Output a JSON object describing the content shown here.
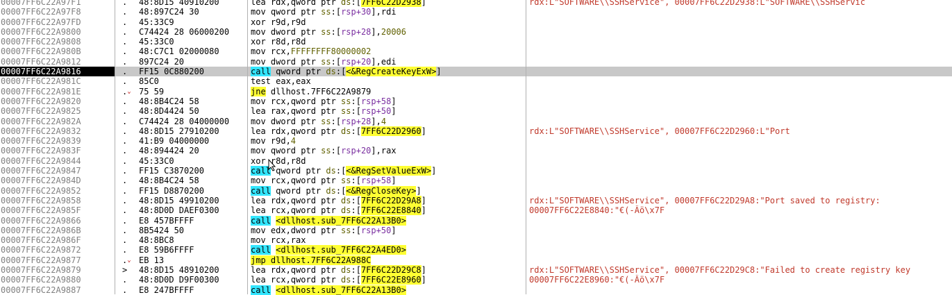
{
  "colors": {
    "address_gray": "#808080",
    "selected_row_bg": "#c8c8c8",
    "selected_addr_bg": "#000000",
    "call_highlight": "#33e6ff",
    "jump_highlight": "#ffff33",
    "comment_color": "#c0392b",
    "jump_arrow_color": "#c00000"
  },
  "rows": [
    {
      "addr": "00007FF6C22A97F1",
      "mark": ".",
      "bytes": "48:8D15 40910200",
      "instr": [
        {
          "t": "lea rdx,qword ptr "
        },
        {
          "t": "ds",
          "c": "seg"
        },
        {
          "t": ":["
        },
        {
          "t": "7FF6C22D2938",
          "c": "hl-y"
        },
        {
          "t": "]"
        }
      ],
      "comment": "rdx:L\"SOFTWARE\\\\SSHService\", 00007FF6C22D2938:L\"SOFTWARE\\\\SSHServic"
    },
    {
      "addr": "00007FF6C22A97F8",
      "mark": ".",
      "bytes": "48:897C24 30",
      "instr": [
        {
          "t": "mov qword ptr "
        },
        {
          "t": "ss",
          "c": "seg"
        },
        {
          "t": ":["
        },
        {
          "t": "rsp+30",
          "c": "reg"
        },
        {
          "t": "],rdi"
        }
      ],
      "comment": ""
    },
    {
      "addr": "00007FF6C22A97FD",
      "mark": ".",
      "bytes": "45:33C9",
      "instr": [
        {
          "t": "xor r9d,r9d"
        }
      ],
      "comment": ""
    },
    {
      "addr": "00007FF6C22A9800",
      "mark": ".",
      "bytes": "C74424 28 06000200",
      "instr": [
        {
          "t": "mov dword ptr "
        },
        {
          "t": "ss",
          "c": "seg"
        },
        {
          "t": ":["
        },
        {
          "t": "rsp+28",
          "c": "reg"
        },
        {
          "t": "],"
        },
        {
          "t": "20006",
          "c": "imm"
        }
      ],
      "comment": ""
    },
    {
      "addr": "00007FF6C22A9808",
      "mark": ".",
      "bytes": "45:33C0",
      "instr": [
        {
          "t": "xor r8d,r8d"
        }
      ],
      "comment": ""
    },
    {
      "addr": "00007FF6C22A980B",
      "mark": ".",
      "bytes": "48:C7C1 02000080",
      "instr": [
        {
          "t": "mov rcx,"
        },
        {
          "t": "FFFFFFFF80000002",
          "c": "imm"
        }
      ],
      "comment": ""
    },
    {
      "addr": "00007FF6C22A9812",
      "mark": ".",
      "bytes": "897C24 20",
      "instr": [
        {
          "t": "mov dword ptr "
        },
        {
          "t": "ss",
          "c": "seg"
        },
        {
          "t": ":["
        },
        {
          "t": "rsp+20",
          "c": "reg"
        },
        {
          "t": "],edi"
        }
      ],
      "comment": ""
    },
    {
      "addr": "00007FF6C22A9816",
      "mark": ".",
      "bytes": "FF15 0C880200",
      "instr": [
        {
          "t": "call",
          "c": "hl-c"
        },
        {
          "t": " qword ptr "
        },
        {
          "t": "ds",
          "c": "seg"
        },
        {
          "t": ":["
        },
        {
          "t": "<&RegCreateKeyExW>",
          "c": "hl-y"
        },
        {
          "t": "]"
        }
      ],
      "comment": "",
      "selected": true
    },
    {
      "addr": "00007FF6C22A981C",
      "mark": ".",
      "bytes": "85C0",
      "instr": [
        {
          "t": "test eax,eax"
        }
      ],
      "comment": ""
    },
    {
      "addr": "00007FF6C22A981E",
      "mark": ".v",
      "bytes": "75 59",
      "instr": [
        {
          "t": "jne",
          "c": "hl-y"
        },
        {
          "t": " dllhost.7FF6C22A9879"
        }
      ],
      "comment": ""
    },
    {
      "addr": "00007FF6C22A9820",
      "mark": ".",
      "bytes": "48:8B4C24 58",
      "instr": [
        {
          "t": "mov rcx,qword ptr "
        },
        {
          "t": "ss",
          "c": "seg"
        },
        {
          "t": ":["
        },
        {
          "t": "rsp+58",
          "c": "reg"
        },
        {
          "t": "]"
        }
      ],
      "comment": ""
    },
    {
      "addr": "00007FF6C22A9825",
      "mark": ".",
      "bytes": "48:8D4424 50",
      "instr": [
        {
          "t": "lea rax,qword ptr "
        },
        {
          "t": "ss",
          "c": "seg"
        },
        {
          "t": ":["
        },
        {
          "t": "rsp+50",
          "c": "reg"
        },
        {
          "t": "]"
        }
      ],
      "comment": ""
    },
    {
      "addr": "00007FF6C22A982A",
      "mark": ".",
      "bytes": "C74424 28 04000000",
      "instr": [
        {
          "t": "mov dword ptr "
        },
        {
          "t": "ss",
          "c": "seg"
        },
        {
          "t": ":["
        },
        {
          "t": "rsp+28",
          "c": "reg"
        },
        {
          "t": "],"
        },
        {
          "t": "4",
          "c": "imm"
        }
      ],
      "comment": ""
    },
    {
      "addr": "00007FF6C22A9832",
      "mark": ".",
      "bytes": "48:8D15 27910200",
      "instr": [
        {
          "t": "lea rdx,qword ptr "
        },
        {
          "t": "ds",
          "c": "seg"
        },
        {
          "t": ":["
        },
        {
          "t": "7FF6C22D2960",
          "c": "hl-y"
        },
        {
          "t": "]"
        }
      ],
      "comment": "rdx:L\"SOFTWARE\\\\SSHService\", 00007FF6C22D2960:L\"Port"
    },
    {
      "addr": "00007FF6C22A9839",
      "mark": ".",
      "bytes": "41:B9 04000000",
      "instr": [
        {
          "t": "mov r9d,"
        },
        {
          "t": "4",
          "c": "imm"
        }
      ],
      "comment": ""
    },
    {
      "addr": "00007FF6C22A983F",
      "mark": ".",
      "bytes": "48:894424 20",
      "instr": [
        {
          "t": "mov qword ptr "
        },
        {
          "t": "ss",
          "c": "seg"
        },
        {
          "t": ":["
        },
        {
          "t": "rsp+20",
          "c": "reg"
        },
        {
          "t": "],rax"
        }
      ],
      "comment": ""
    },
    {
      "addr": "00007FF6C22A9844",
      "mark": ".",
      "bytes": "45:33C0",
      "instr": [
        {
          "t": "xor r8d,r8d"
        }
      ],
      "comment": ""
    },
    {
      "addr": "00007FF6C22A9847",
      "mark": ".",
      "bytes": "FF15 C3870200",
      "instr": [
        {
          "t": "call",
          "c": "hl-c"
        },
        {
          "t": " qword ptr "
        },
        {
          "t": "ds",
          "c": "seg"
        },
        {
          "t": ":["
        },
        {
          "t": "<&RegSetValueExW>",
          "c": "hl-y"
        },
        {
          "t": "]"
        }
      ],
      "comment": ""
    },
    {
      "addr": "00007FF6C22A984D",
      "mark": ".",
      "bytes": "48:8B4C24 58",
      "instr": [
        {
          "t": "mov rcx,qword ptr "
        },
        {
          "t": "ss",
          "c": "seg"
        },
        {
          "t": ":["
        },
        {
          "t": "rsp+58",
          "c": "reg"
        },
        {
          "t": "]"
        }
      ],
      "comment": ""
    },
    {
      "addr": "00007FF6C22A9852",
      "mark": ".",
      "bytes": "FF15 D8870200",
      "instr": [
        {
          "t": "call",
          "c": "hl-c"
        },
        {
          "t": " qword ptr "
        },
        {
          "t": "ds",
          "c": "seg"
        },
        {
          "t": ":["
        },
        {
          "t": "<&RegCloseKey>",
          "c": "hl-y"
        },
        {
          "t": "]"
        }
      ],
      "comment": ""
    },
    {
      "addr": "00007FF6C22A9858",
      "mark": ".",
      "bytes": "48:8D15 49910200",
      "instr": [
        {
          "t": "lea rdx,qword ptr "
        },
        {
          "t": "ds",
          "c": "seg"
        },
        {
          "t": ":["
        },
        {
          "t": "7FF6C22D29A8",
          "c": "hl-y"
        },
        {
          "t": "]"
        }
      ],
      "comment": "rdx:L\"SOFTWARE\\\\SSHService\", 00007FF6C22D29A8:\"Port saved to registry:"
    },
    {
      "addr": "00007FF6C22A985F",
      "mark": ".",
      "bytes": "48:8D0D DAEF0300",
      "instr": [
        {
          "t": "lea rcx,qword ptr "
        },
        {
          "t": "ds",
          "c": "seg"
        },
        {
          "t": ":["
        },
        {
          "t": "7FF6C22E8840",
          "c": "hl-y"
        },
        {
          "t": "]"
        }
      ],
      "comment": "00007FF6C22E8840:\"€(-Âö\\x7F"
    },
    {
      "addr": "00007FF6C22A9866",
      "mark": ".",
      "bytes": "E8 457BFFFF",
      "instr": [
        {
          "t": "call",
          "c": "hl-c"
        },
        {
          "t": " "
        },
        {
          "t": "<dllhost.sub_7FF6C22A13B0>",
          "c": "hl-y"
        }
      ],
      "comment": ""
    },
    {
      "addr": "00007FF6C22A986B",
      "mark": ".",
      "bytes": "8B5424 50",
      "instr": [
        {
          "t": "mov edx,dword ptr "
        },
        {
          "t": "ss",
          "c": "seg"
        },
        {
          "t": ":["
        },
        {
          "t": "rsp+50",
          "c": "reg"
        },
        {
          "t": "]"
        }
      ],
      "comment": ""
    },
    {
      "addr": "00007FF6C22A986F",
      "mark": ".",
      "bytes": "48:8BC8",
      "instr": [
        {
          "t": "mov rcx,rax"
        }
      ],
      "comment": ""
    },
    {
      "addr": "00007FF6C22A9872",
      "mark": ".",
      "bytes": "E8 59B6FFFF",
      "instr": [
        {
          "t": "call",
          "c": "hl-c"
        },
        {
          "t": " "
        },
        {
          "t": "<dllhost.sub_7FF6C22A4ED0>",
          "c": "hl-y"
        }
      ],
      "comment": ""
    },
    {
      "addr": "00007FF6C22A9877",
      "mark": ".v",
      "bytes": "EB 13",
      "instr": [
        {
          "t": "jmp dllhost.7FF6C22A988C",
          "c": "hl-y"
        }
      ],
      "comment": ""
    },
    {
      "addr": "00007FF6C22A9879",
      "mark": ">",
      "bytes": "48:8D15 48910200",
      "instr": [
        {
          "t": "lea rdx,qword ptr "
        },
        {
          "t": "ds",
          "c": "seg"
        },
        {
          "t": ":["
        },
        {
          "t": "7FF6C22D29C8",
          "c": "hl-y"
        },
        {
          "t": "]"
        }
      ],
      "comment": "rdx:L\"SOFTWARE\\\\SSHService\", 00007FF6C22D29C8:\"Failed to create registry key"
    },
    {
      "addr": "00007FF6C22A9880",
      "mark": ".",
      "bytes": "48:8D0D D9F00300",
      "instr": [
        {
          "t": "lea rcx,qword ptr "
        },
        {
          "t": "ds",
          "c": "seg"
        },
        {
          "t": ":["
        },
        {
          "t": "7FF6C22E8960",
          "c": "hl-y"
        },
        {
          "t": "]"
        }
      ],
      "comment": "00007FF6C22E8960:\"€(-Âö\\x7F"
    },
    {
      "addr": "00007FF6C22A9887",
      "mark": ".",
      "bytes": "E8 247BFFFF",
      "instr": [
        {
          "t": "call",
          "c": "hl-c"
        },
        {
          "t": " "
        },
        {
          "t": "<dllhost.sub_7FF6C22A13B0>",
          "c": "hl-y"
        }
      ],
      "comment": ""
    }
  ]
}
